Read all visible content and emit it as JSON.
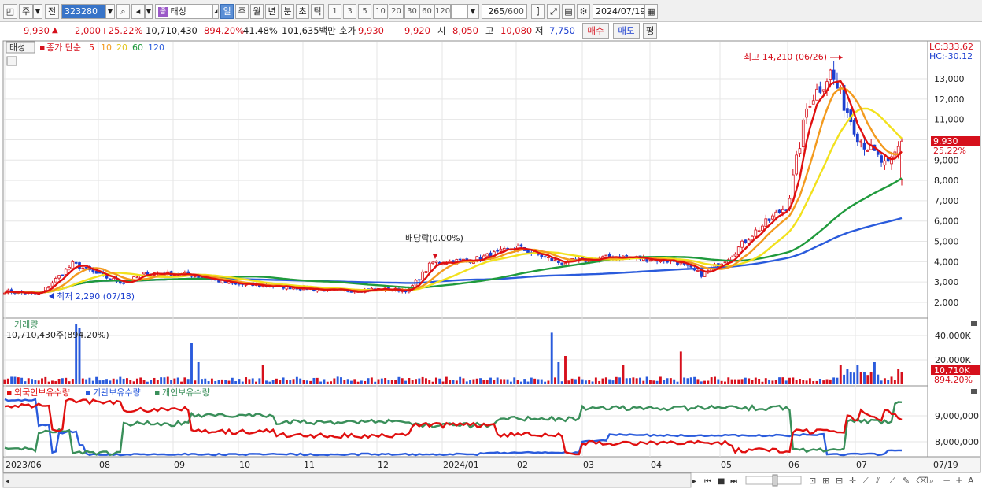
{
  "toolbar": {
    "market": "주",
    "scope": "전",
    "stock_code": "323280",
    "stock_name": "태성",
    "period_tabs": [
      "일",
      "주",
      "월",
      "년",
      "분",
      "초",
      "틱"
    ],
    "active_period": "일",
    "minute_options": [
      "1",
      "3",
      "5",
      "10",
      "20",
      "30",
      "60",
      "120"
    ],
    "count_value": "265",
    "count_max": "/600",
    "date": "2024/07/19"
  },
  "quote": {
    "price": "9,930",
    "change_arrow": "▲",
    "change": "2,000",
    "change_pct": "+25.22%",
    "volume": "10,710,430",
    "volume_ratio": "894.20%",
    "turnover_pct": "41.48%",
    "amount": "101,635백만",
    "ask_label": "호가",
    "ask": "9,930",
    "bid": "9,920",
    "open_label": "시",
    "open": "8,050",
    "high_label": "고",
    "high": "10,080",
    "low_label": "저",
    "low": "7,750",
    "buy_label": "매수",
    "sell_label": "매도",
    "avg_label": "평"
  },
  "price_panel": {
    "name_tag": "태성",
    "series_label": "종가 단순",
    "ma_periods": [
      "5",
      "10",
      "20",
      "60",
      "120"
    ],
    "ma_colors": [
      "#e01010",
      "#f39a1e",
      "#f2e11d",
      "#1f9a3c",
      "#2a5bdc"
    ],
    "lc_label": "LC:333.62",
    "hc_label": "HC:-30.12",
    "high_note": "최고 14,210 (06/26)",
    "low_note": "최저 2,290 (07/18)",
    "dividend_note": "배당락(0.00%)",
    "price_tag": "9,930",
    "change_tag": "25.22%",
    "y_ticks": [
      "13,000",
      "12,000",
      "11,000",
      "10,000",
      "9,000",
      "8,000",
      "7,000",
      "6,000",
      "5,000",
      "4,000",
      "3,000",
      "2,000"
    ]
  },
  "volume_panel": {
    "title": "거래량",
    "summary": "10,710,430주(894.20%)",
    "y_ticks": [
      "40,000K",
      "20,000K"
    ],
    "value_tag": "10,710K",
    "ratio_tag": "894.20%"
  },
  "holdings_panel": {
    "legend": [
      "외국인보유수량",
      "기관보유수량",
      "개인보유수량"
    ],
    "legend_colors": [
      "#e01010",
      "#2a5bdc",
      "#3a8f5a"
    ],
    "y_ticks": [
      "9,000,000",
      "8,000,000"
    ]
  },
  "x_axis": {
    "labels": [
      "2023/06",
      "08",
      "09",
      "10",
      "11",
      "12",
      "2024/01",
      "02",
      "03",
      "04",
      "05",
      "06",
      "07"
    ],
    "right_label": "07/19"
  },
  "colors": {
    "up": "#d6101c",
    "down": "#1c3fd0",
    "grid": "#e4e4e4",
    "accent": "#3874c8"
  },
  "chart_data": {
    "type": "candlestick",
    "ylim": [
      1500,
      14500
    ],
    "high": 14210,
    "low": 2290,
    "last_close": 9930
  }
}
